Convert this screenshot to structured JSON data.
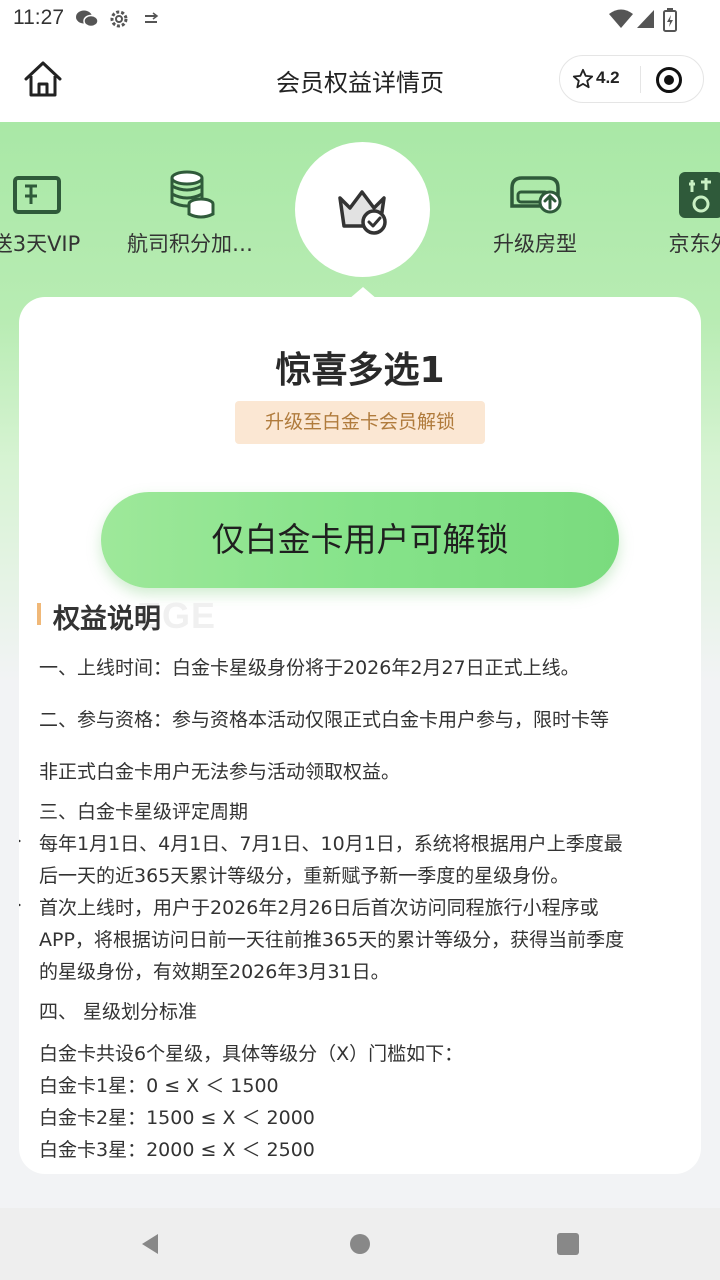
{
  "status_bar": {
    "time": "11:27",
    "icons": [
      "wechat-icon",
      "settings-icon",
      "data-icon",
      "wifi-icon",
      "signal-icon",
      "battery-icon"
    ]
  },
  "nav": {
    "title": "会员权益详情页",
    "rating": "4.2",
    "icons": [
      "home-icon",
      "star-icon",
      "target-icon"
    ]
  },
  "benefits": {
    "items": [
      {
        "label": "送3天VIP",
        "icon": "ticket-icon"
      },
      {
        "label": "航司积分加…",
        "icon": "coins-icon"
      },
      {
        "label": "",
        "icon": "crown-check-icon"
      },
      {
        "label": "升级房型",
        "icon": "sofa-upgrade-icon"
      },
      {
        "label": "京东外",
        "icon": "waimai-icon"
      }
    ]
  },
  "card": {
    "title": "惊喜多选1",
    "unlock_badge": "升级至白金卡会员解锁",
    "unlock_button": "仅白金卡用户可解锁",
    "section_title": "权益说明",
    "section_watermark": "EGE",
    "lines": [
      "一、上线时间：白金卡星级身份将于2026年2月27日正式上线。",
      "二、参与资格：参与资格本活动仅限正式白金卡用户参与，限时卡等",
      "非正式白金卡用户无法参与活动领取权益。",
      "三、白金卡星级评定周期",
      "每年1月1日、4月1日、7月1日、10月1日，系统将根据用户上季度最",
      "后一天的近365天累计等级分，重新赋予新一季度的星级身份。",
      "首次上线时，用户于2026年2月26日后首次访问同程旅行小程序或",
      "APP，将根据访问日前一天往前推365天的累计等级分，获得当前季度",
      "的星级身份，有效期至2026年3月31日。",
      "四、 星级划分标准",
      "白金卡共设6个星级，具体等级分（X）门槛如下：",
      "白金卡1星：0 ≤ X ＜ 1500",
      "白金卡2星：1500 ≤ X ＜ 2000",
      "白金卡3星：2000 ≤ X ＜ 2500"
    ]
  },
  "colors": {
    "hero_green": "#a9e8a6",
    "button_green": "#86e38a",
    "badge_bg": "#fbe7d3",
    "badge_text": "#b07b3c",
    "section_accent": "#f0b878",
    "icon_dark_green": "#2f5a3a"
  }
}
